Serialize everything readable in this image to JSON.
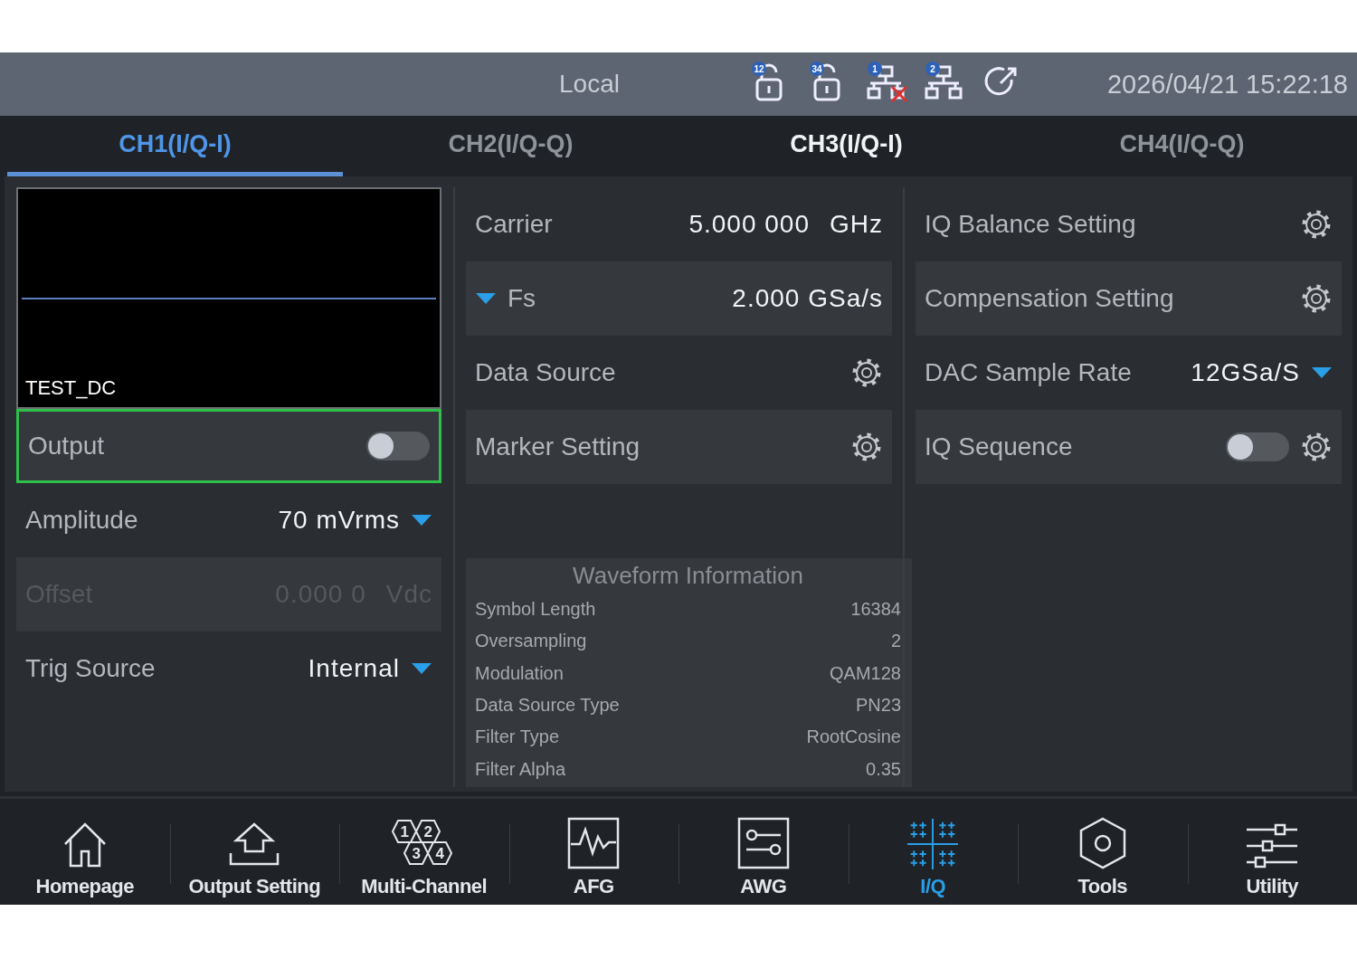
{
  "status_bar": {
    "mode": "Local",
    "indicators": [
      {
        "kind": "lock",
        "badge": "12"
      },
      {
        "kind": "lock",
        "badge": "34"
      },
      {
        "kind": "network",
        "badge": "1",
        "error": true
      },
      {
        "kind": "network",
        "badge": "2",
        "error": false
      },
      {
        "kind": "refresh"
      }
    ],
    "datetime": "2026/04/21 15:22:18"
  },
  "tabs": [
    {
      "label": "CH1(I/Q-I)",
      "selected": true,
      "active": false
    },
    {
      "label": "CH2(I/Q-Q)",
      "selected": false,
      "active": false
    },
    {
      "label": "CH3(I/Q-I)",
      "selected": false,
      "active": true
    },
    {
      "label": "CH4(I/Q-Q)",
      "selected": false,
      "active": false
    }
  ],
  "preview": {
    "waveform_name": "TEST_DC"
  },
  "left_settings": [
    {
      "kind": "toggle",
      "label": "Output",
      "on": false,
      "focused": true
    },
    {
      "kind": "dropdown",
      "label": "Amplitude",
      "value": "70 mVrms"
    },
    {
      "kind": "value",
      "label": "Offset",
      "value": "0.000 0",
      "unit": "Vdc",
      "disabled": true
    },
    {
      "kind": "dropdown",
      "label": "Trig Source",
      "value": "Internal"
    }
  ],
  "middle_settings": [
    {
      "kind": "value",
      "label": "Carrier",
      "value": "5.000 000",
      "unit": "GHz"
    },
    {
      "kind": "expander",
      "label": "Fs",
      "value": "2.000 GSa/s"
    },
    {
      "kind": "settings",
      "label": "Data Source"
    },
    {
      "kind": "settings",
      "label": "Marker Setting"
    }
  ],
  "waveform_information": {
    "title": "Waveform Information",
    "rows": [
      {
        "label": "Symbol Length",
        "value": "16384"
      },
      {
        "label": "Oversampling",
        "value": "2"
      },
      {
        "label": "Modulation",
        "value": "QAM128"
      },
      {
        "label": "Data Source Type",
        "value": "PN23"
      },
      {
        "label": "Filter Type",
        "value": "RootCosine"
      },
      {
        "label": "Filter Alpha",
        "value": "0.35"
      }
    ]
  },
  "right_settings": [
    {
      "kind": "settings",
      "label": "IQ Balance Setting"
    },
    {
      "kind": "settings",
      "label": "Compensation Setting"
    },
    {
      "kind": "dropdown",
      "label": "DAC Sample Rate",
      "value": "12GSa/S"
    },
    {
      "kind": "toggle_settings",
      "label": "IQ Sequence",
      "on": false
    }
  ],
  "nav": [
    {
      "kind": "home",
      "label": "Homepage",
      "selected": false
    },
    {
      "kind": "output",
      "label": "Output Setting",
      "selected": false
    },
    {
      "kind": "channels",
      "label": "Multi-Channel",
      "selected": false,
      "numbers": [
        "1",
        "2",
        "3",
        "4"
      ]
    },
    {
      "kind": "afg",
      "label": "AFG",
      "selected": false
    },
    {
      "kind": "awg",
      "label": "AWG",
      "selected": false
    },
    {
      "kind": "iq",
      "label": "I/Q",
      "selected": true
    },
    {
      "kind": "tools",
      "label": "Tools",
      "selected": false
    },
    {
      "kind": "utility",
      "label": "Utility",
      "selected": false
    }
  ]
}
